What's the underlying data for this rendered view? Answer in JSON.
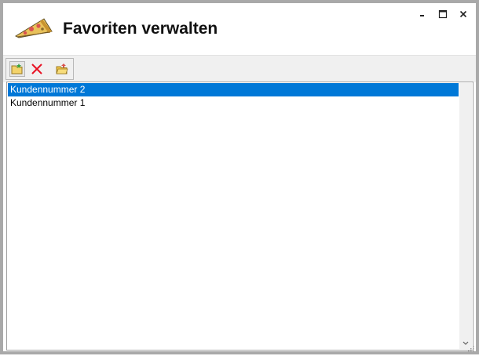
{
  "window": {
    "title": "Favoriten verwalten",
    "app_icon": "pizza-icon",
    "controls": [
      "minimize-icon",
      "maximize-icon",
      "close-icon"
    ]
  },
  "toolbar": {
    "buttons": [
      {
        "name": "new-favorite",
        "icon": "folder-new-icon"
      },
      {
        "name": "delete",
        "icon": "delete-x-icon",
        "color": "#e81123"
      },
      {
        "name": "open-folder",
        "icon": "folder-open-icon"
      }
    ]
  },
  "list": {
    "items": [
      {
        "label": "Kundennummer 2",
        "selected": true
      },
      {
        "label": "Kundennummer 1",
        "selected": false
      }
    ],
    "selection_color": "#0078d7"
  }
}
